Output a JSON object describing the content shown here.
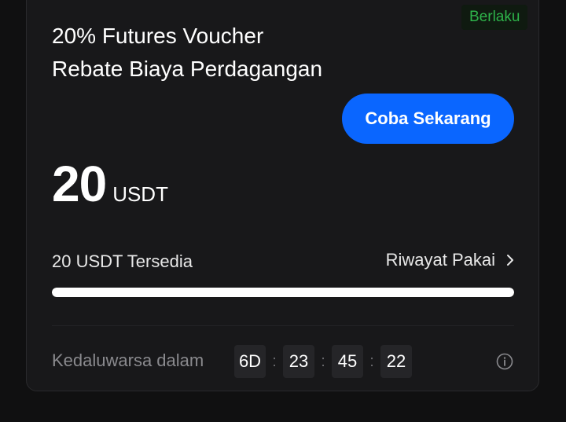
{
  "status": "Berlaku",
  "voucher": {
    "title": "20% Futures Voucher Rebate Biaya Perdagangan",
    "amount": "20",
    "unit": "USDT",
    "cta_label": "Coba Sekarang"
  },
  "balance": {
    "available_text": "20 USDT Tersedia",
    "history_label": "Riwayat Pakai",
    "progress_fraction": 1.0
  },
  "expiry": {
    "label": "Kedaluwarsa dalam",
    "days": "6D",
    "hours": "23",
    "minutes": "45",
    "seconds": "22",
    "separator": ":"
  },
  "icons": {
    "history_chevron": "chevron-right-icon",
    "info": "info-icon"
  },
  "colors": {
    "accent": "#0a66ff",
    "status": "#2eb34a",
    "background": "#101011",
    "card": "#18181a"
  }
}
